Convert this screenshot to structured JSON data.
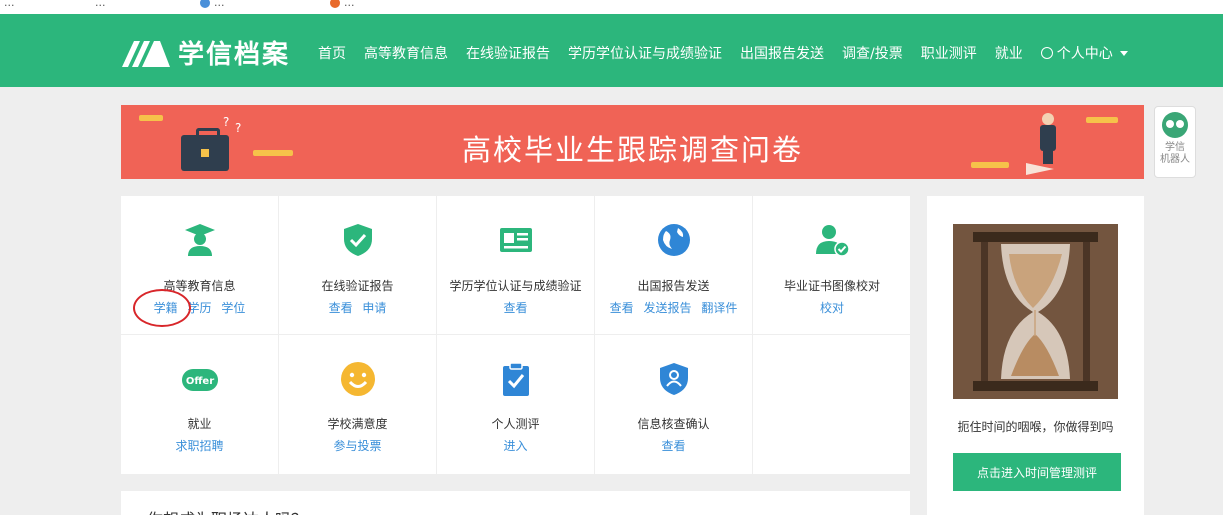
{
  "bookmarks": [
    {
      "label": "...",
      "icon": "page-icon"
    },
    {
      "label": "...",
      "icon": "page-icon"
    },
    {
      "label": "...",
      "icon": "globe-icon"
    },
    {
      "label": "...",
      "icon": "orange-circle-icon"
    }
  ],
  "header": {
    "logo_text": "学信档案",
    "nav": [
      "首页",
      "高等教育信息",
      "在线验证报告",
      "学历学位认证与成绩验证",
      "出国报告发送",
      "调查/投票",
      "职业测评",
      "就业"
    ],
    "user_menu": "个人中心",
    "brand_color": "#2cb67c"
  },
  "banner": {
    "title": "高校毕业生跟踪调查问卷",
    "background": "#f06356"
  },
  "robot": {
    "label_line1": "学信",
    "label_line2": "机器人"
  },
  "services": [
    {
      "name": "高等教育信息",
      "icon": "graduate-icon",
      "color": "#2cb67c",
      "links": [
        "学籍",
        "学历",
        "学位"
      ]
    },
    {
      "name": "在线验证报告",
      "icon": "shield-check-icon",
      "color": "#2cb67c",
      "links": [
        "查看",
        "申请"
      ]
    },
    {
      "name": "学历学位认证与成绩验证",
      "icon": "id-card-icon",
      "color": "#2cb67c",
      "links": [
        "查看"
      ]
    },
    {
      "name": "出国报告发送",
      "icon": "globe-icon",
      "color": "#2f86d6",
      "links": [
        "查看",
        "发送报告",
        "翻译件"
      ]
    },
    {
      "name": "毕业证书图像校对",
      "icon": "user-check-icon",
      "color": "#2cb67c",
      "links": [
        "校对"
      ]
    },
    {
      "name": "就业",
      "icon": "offer-icon",
      "badge": "Offer",
      "color": "#2cb67c",
      "links": [
        "求职招聘"
      ]
    },
    {
      "name": "学校满意度",
      "icon": "smiley-icon",
      "color": "#f5b731",
      "links": [
        "参与投票"
      ]
    },
    {
      "name": "个人测评",
      "icon": "clipboard-check-icon",
      "color": "#2f86d6",
      "links": [
        "进入"
      ]
    },
    {
      "name": "信息核查确认",
      "icon": "shield-user-icon",
      "color": "#2f86d6",
      "links": [
        "查看"
      ]
    }
  ],
  "side": {
    "caption": "扼住时间的咽喉，你做得到吗",
    "button": "点击进入时间管理测评"
  },
  "bottom": {
    "title": "你想成为职场达人吗？...",
    "more": "..."
  }
}
